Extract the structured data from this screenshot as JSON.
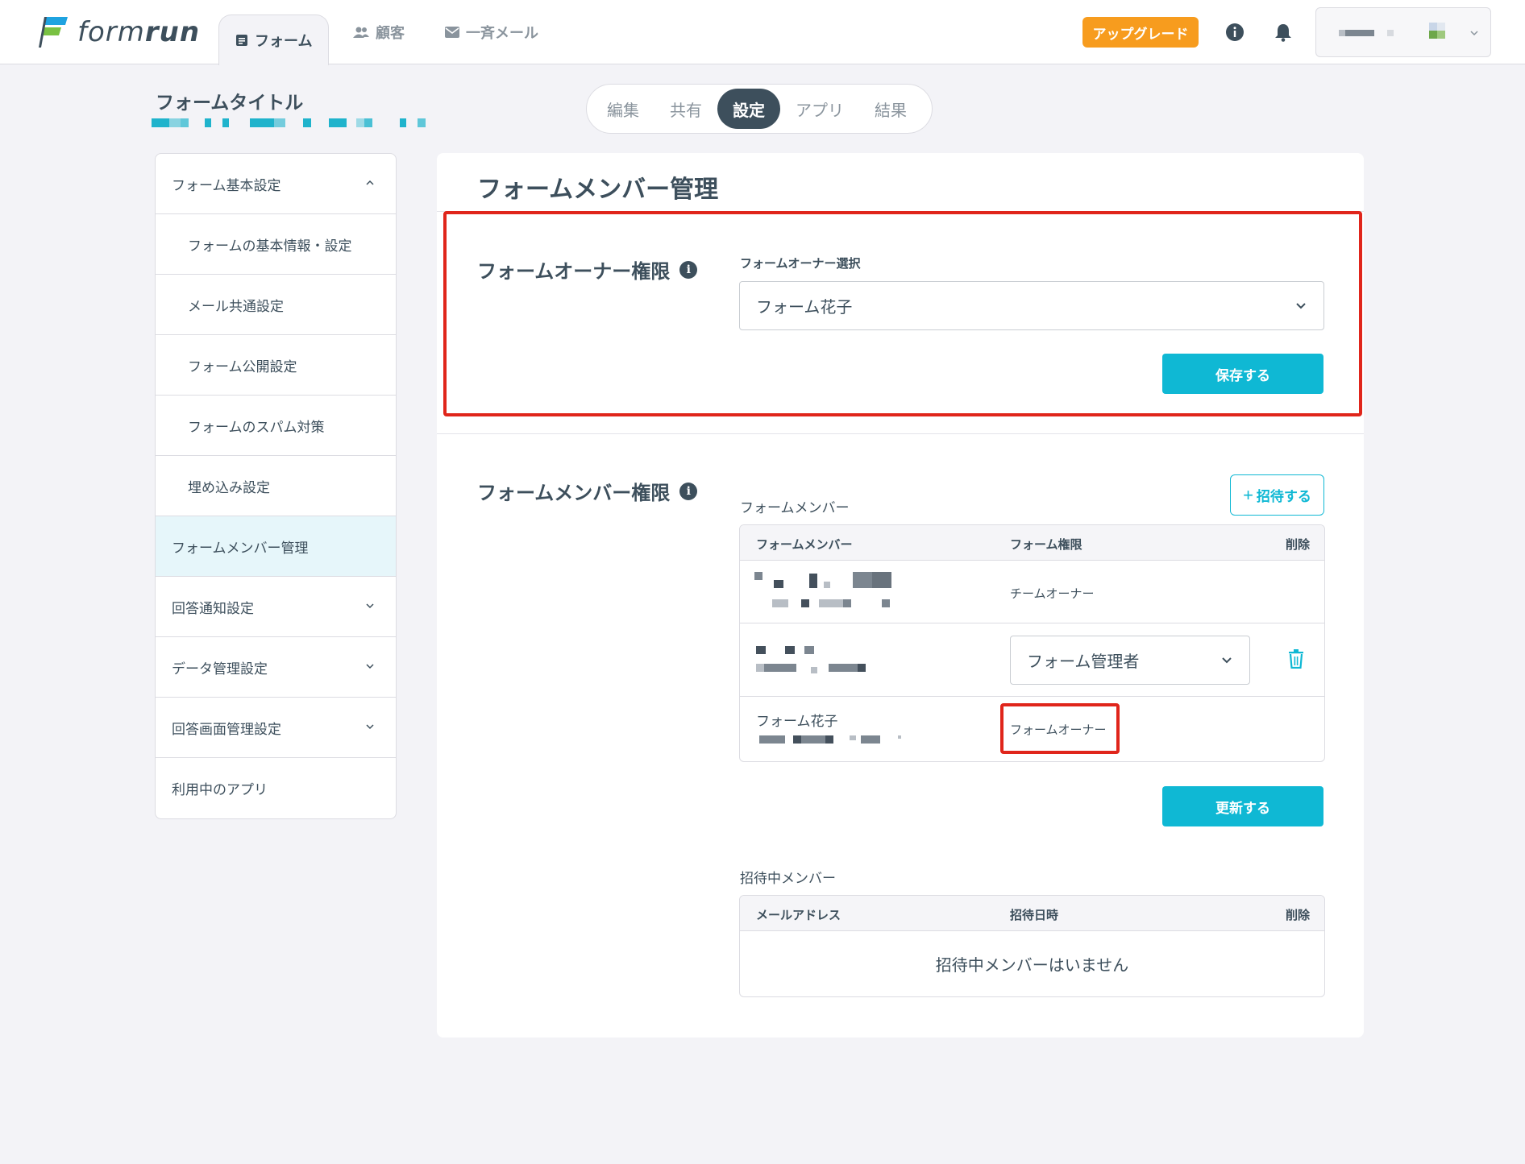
{
  "header": {
    "logo_text_light": "form",
    "logo_text_bold": "run",
    "nav": [
      {
        "label": "フォーム",
        "icon": "form-icon",
        "active": true
      },
      {
        "label": "顧客",
        "icon": "people-icon",
        "active": false
      },
      {
        "label": "一斉メール",
        "icon": "mail-icon",
        "active": false
      }
    ],
    "upgrade_label": "アップグレード"
  },
  "form_title": "フォームタイトル",
  "segments": [
    "編集",
    "共有",
    "設定",
    "アプリ",
    "結果"
  ],
  "active_segment": "設定",
  "sidebar": [
    {
      "label": "フォーム基本設定",
      "chevron": "up",
      "sub": false
    },
    {
      "label": "フォームの基本情報・設定",
      "sub": true
    },
    {
      "label": "メール共通設定",
      "sub": true
    },
    {
      "label": "フォーム公開設定",
      "sub": true
    },
    {
      "label": "フォームのスパム対策",
      "sub": true
    },
    {
      "label": "埋め込み設定",
      "sub": true
    },
    {
      "label": "フォームメンバー管理",
      "active": true
    },
    {
      "label": "回答通知設定",
      "chevron": "down"
    },
    {
      "label": "データ管理設定",
      "chevron": "down"
    },
    {
      "label": "回答画面管理設定",
      "chevron": "down"
    },
    {
      "label": "利用中のアプリ"
    }
  ],
  "main": {
    "title": "フォームメンバー管理",
    "owner_section": {
      "heading": "フォームオーナー権限",
      "field_label": "フォームオーナー選択",
      "selected": "フォーム花子",
      "save_label": "保存する"
    },
    "member_section": {
      "heading": "フォームメンバー権限",
      "list_label": "フォームメンバー",
      "invite_label": "招待する",
      "columns": [
        "フォームメンバー",
        "フォーム権限",
        "削除"
      ],
      "rows": [
        {
          "name": "",
          "role": "チームオーナー"
        },
        {
          "name": "",
          "role_select": "フォーム管理者"
        },
        {
          "name": "フォーム花子",
          "role": "フォームオーナー"
        }
      ],
      "update_label": "更新する"
    },
    "invite_section": {
      "label": "招待中メンバー",
      "columns": [
        "メールアドレス",
        "招待日時",
        "削除"
      ],
      "empty": "招待中メンバーはいません"
    }
  },
  "colors": {
    "accent": "#0fb8d4",
    "upgrade": "#f79c1e",
    "highlight": "#e0251b",
    "text": "#3d4f5c"
  }
}
